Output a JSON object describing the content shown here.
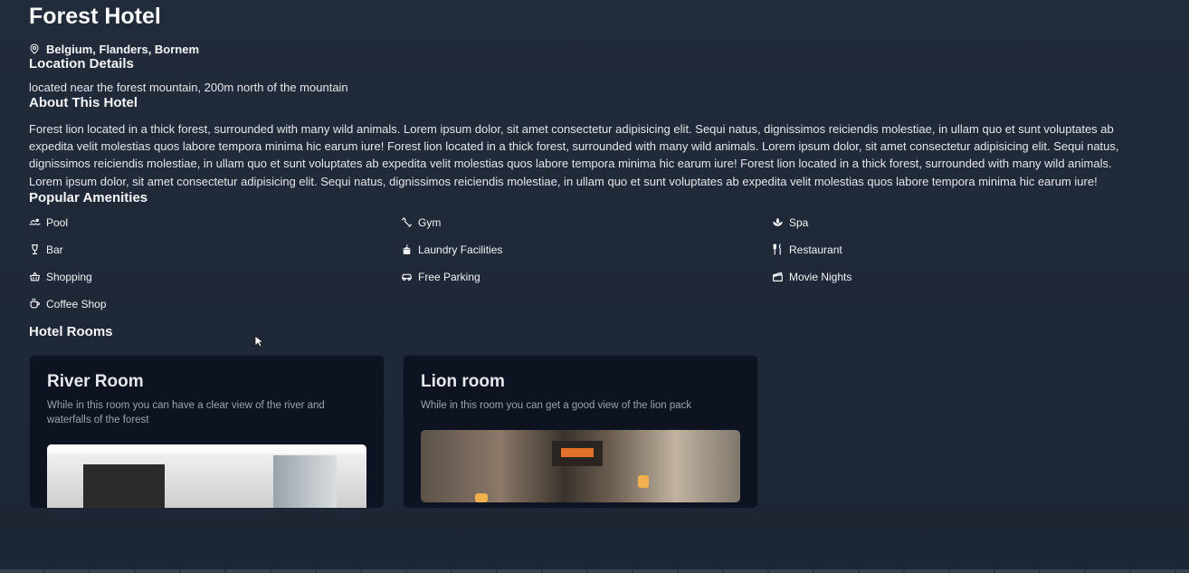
{
  "hotel": {
    "name": "Forest Hotel",
    "location": "Belgium, Flanders, Bornem"
  },
  "location_details": {
    "heading": "Location Details",
    "text": "located near the forest mountain, 200m north of the mountain"
  },
  "about": {
    "heading": "About This Hotel",
    "text": "Forest lion located in a thick forest, surrounded with many wild animals. Lorem ipsum dolor, sit amet consectetur adipisicing elit. Sequi natus, dignissimos reiciendis molestiae, in ullam quo et sunt voluptates ab expedita velit molestias quos labore tempora minima hic earum iure! Forest lion located in a thick forest, surrounded with many wild animals. Lorem ipsum dolor, sit amet consectetur adipisicing elit. Sequi natus, dignissimos reiciendis molestiae, in ullam quo et sunt voluptates ab expedita velit molestias quos labore tempora minima hic earum iure! Forest lion located in a thick forest, surrounded with many wild animals. Lorem ipsum dolor, sit amet consectetur adipisicing elit. Sequi natus, dignissimos reiciendis molestiae, in ullam quo et sunt voluptates ab expedita velit molestias quos labore tempora minima hic earum iure!"
  },
  "amenities": {
    "heading": "Popular Amenities",
    "items": [
      {
        "label": "Pool",
        "icon": "pool-icon"
      },
      {
        "label": "Gym",
        "icon": "gym-icon"
      },
      {
        "label": "Spa",
        "icon": "spa-icon"
      },
      {
        "label": "Bar",
        "icon": "bar-icon"
      },
      {
        "label": "Laundry Facilities",
        "icon": "laundry-icon"
      },
      {
        "label": "Restaurant",
        "icon": "restaurant-icon"
      },
      {
        "label": "Shopping",
        "icon": "shopping-basket-icon"
      },
      {
        "label": "Free Parking",
        "icon": "car-icon"
      },
      {
        "label": "Movie Nights",
        "icon": "clapperboard-icon"
      },
      {
        "label": "Coffee Shop",
        "icon": "coffee-cup-icon"
      }
    ]
  },
  "rooms": {
    "heading": "Hotel Rooms",
    "items": [
      {
        "name": "River Room",
        "description": "While in this room you can have a clear view of the river and waterfalls of the forest"
      },
      {
        "name": "Lion room",
        "description": "While in this room you can get a good view of the lion pack"
      }
    ]
  },
  "colors": {
    "background": "#1f2937",
    "card": "#0d1320",
    "muted_text": "#9ca3af"
  }
}
